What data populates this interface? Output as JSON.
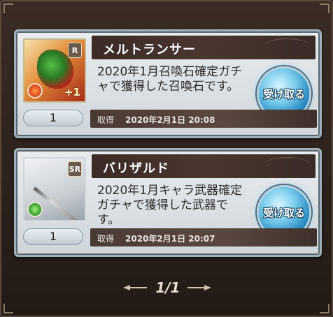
{
  "items": [
    {
      "name": "メルトランサー",
      "description": "2020年1月召喚石確定ガチャで獲得した召喚石です。",
      "rarity_badge": "R",
      "element": "fire",
      "uncap": "+1",
      "quantity": "1",
      "obtained_label": "取得",
      "obtained_date": "2020年2月1日 20:08",
      "receive_label": "受け取る"
    },
    {
      "name": "バリザルド",
      "description": "2020年1月キャラ武器確定ガチャで獲得した武器です。",
      "rarity_badge": "SR",
      "element": "wind",
      "quantity": "1",
      "obtained_label": "取得",
      "obtained_date": "2020年2月1日 20:07",
      "receive_label": "受け取る"
    }
  ],
  "pager": {
    "page": "1/1"
  }
}
